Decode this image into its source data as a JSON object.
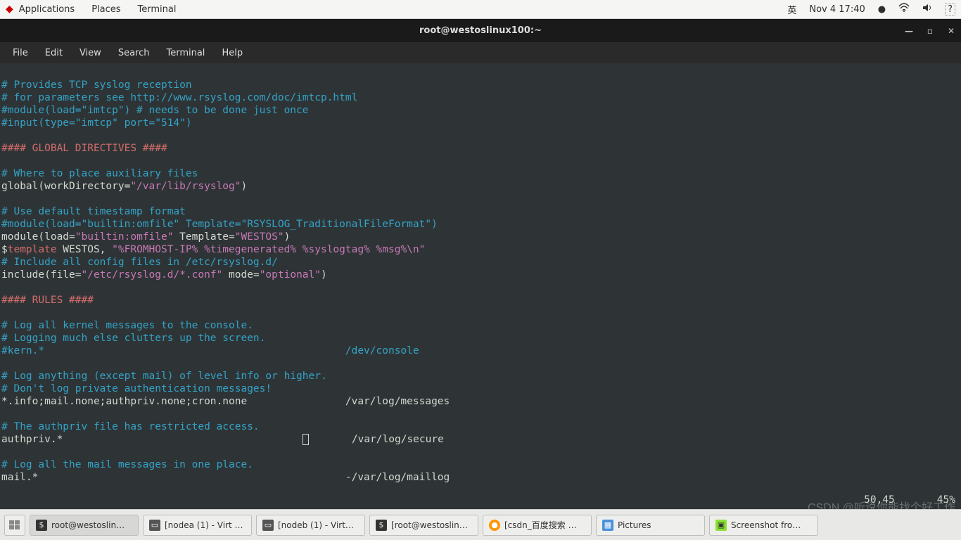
{
  "topbar": {
    "applications": "Applications",
    "places": "Places",
    "terminal": "Terminal",
    "input_method": "英",
    "clock": "Nov 4  17:40"
  },
  "window": {
    "title": "root@westoslinux100:~"
  },
  "menubar": {
    "file": "File",
    "edit": "Edit",
    "view": "View",
    "search": "Search",
    "terminal": "Terminal",
    "help": "Help"
  },
  "code": {
    "l1": "# Provides TCP syslog reception",
    "l2": "# for parameters see http://www.rsyslog.com/doc/imtcp.html",
    "l3a": "#module(load=\"imtcp\")",
    "l3b": " # needs to be done just once",
    "l4": "#input(type=\"imtcp\" port=\"514\")",
    "l5": "#### GLOBAL DIRECTIVES ####",
    "l6": "# Where to place auxiliary files",
    "l7a": "global(workDirectory=",
    "l7b": "\"/var/lib/rsyslog\"",
    "l7c": ")",
    "l8": "# Use default timestamp format",
    "l9": "#module(load=\"builtin:omfile\" Template=\"RSYSLOG_TraditionalFileFormat\")",
    "l10a": "module(load=",
    "l10b": "\"builtin:omfile\"",
    "l10c": " Template=",
    "l10d": "\"WESTOS\"",
    "l10e": ")",
    "l11a": "$",
    "l11b": "template",
    "l11c": " WESTOS, ",
    "l11d": "\"%FROMHOST-IP% %timegenerated% %syslogtag% %msg%\\n\"",
    "l12": "# Include all config files in /etc/rsyslog.d/",
    "l13a": "include(file=",
    "l13b": "\"/etc/rsyslog.d/*.conf\"",
    "l13c": " mode=",
    "l13d": "\"optional\"",
    "l13e": ")",
    "l14": "#### RULES ####",
    "l15": "# Log all kernel messages to the console.",
    "l16": "# Logging much else clutters up the screen.",
    "l17": "#kern.*                                                 /dev/console",
    "l18": "# Log anything (except mail) of level info or higher.",
    "l19": "# Don't log private authentication messages!",
    "l20": "*.info;mail.none;authpriv.none;cron.none                /var/log/messages",
    "l21": "# The authpriv file has restricted access.",
    "l22a": "authpriv.*                                       ",
    "l22b": "       /var/log/secure",
    "l23": "# Log all the mail messages in one place.",
    "l24": "mail.*                                                  -/var/log/maillog"
  },
  "status": {
    "pos": "50,45",
    "pct": "45%"
  },
  "taskbar": {
    "t1": "root@westoslin…",
    "t2": "[nodea (1) - Virt …",
    "t3": "[nodeb (1) - Virt…",
    "t4": "[root@westoslin…",
    "t5": "[csdn_百度搜索 …",
    "t6": "Pictures",
    "t7": "Screenshot fro…"
  },
  "watermark": "CSDN @听说你能找个好工作"
}
